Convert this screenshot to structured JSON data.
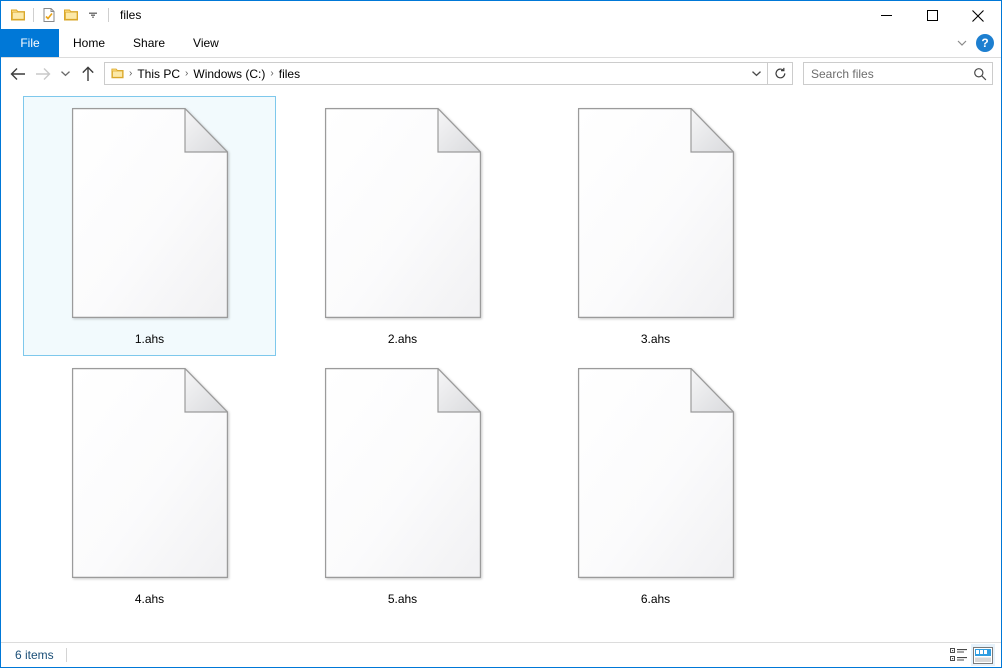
{
  "window": {
    "title": "files",
    "quick_access": [
      {
        "name": "folder-icon",
        "label": "Folder"
      },
      {
        "name": "properties-icon",
        "label": "Properties"
      },
      {
        "name": "new-folder-icon",
        "label": "New folder"
      },
      {
        "name": "chevron-down-icon",
        "label": "Customize Quick Access Toolbar"
      }
    ],
    "controls": [
      {
        "name": "minimize-button",
        "label": "Minimize"
      },
      {
        "name": "maximize-button",
        "label": "Maximize"
      },
      {
        "name": "close-button",
        "label": "Close"
      }
    ],
    "accent_color": "#0078d7"
  },
  "ribbon": {
    "tabs": [
      {
        "label": "File",
        "active": true
      },
      {
        "label": "Home",
        "active": false
      },
      {
        "label": "Share",
        "active": false
      },
      {
        "label": "View",
        "active": false
      }
    ],
    "collapse_label": "Minimize the Ribbon",
    "help_label": "?"
  },
  "navigation": {
    "back_label": "Back",
    "forward_label": "Forward",
    "recent_label": "Recent locations",
    "up_label": "Up one level",
    "breadcrumbs": [
      {
        "label": "This PC"
      },
      {
        "label": "Windows (C:)"
      },
      {
        "label": "files"
      }
    ],
    "separator": "›",
    "dropdown_label": "Previous locations",
    "refresh_label": "Refresh"
  },
  "search": {
    "placeholder": "Search files",
    "value": "Search files"
  },
  "files": [
    {
      "name": "1.ahs",
      "selected": true
    },
    {
      "name": "2.ahs",
      "selected": false
    },
    {
      "name": "3.ahs",
      "selected": false
    },
    {
      "name": "4.ahs",
      "selected": false
    },
    {
      "name": "5.ahs",
      "selected": false
    },
    {
      "name": "6.ahs",
      "selected": false
    }
  ],
  "status": {
    "item_count": "6 items",
    "view_details_label": "Details view",
    "view_large_icons_label": "Large icons view"
  }
}
